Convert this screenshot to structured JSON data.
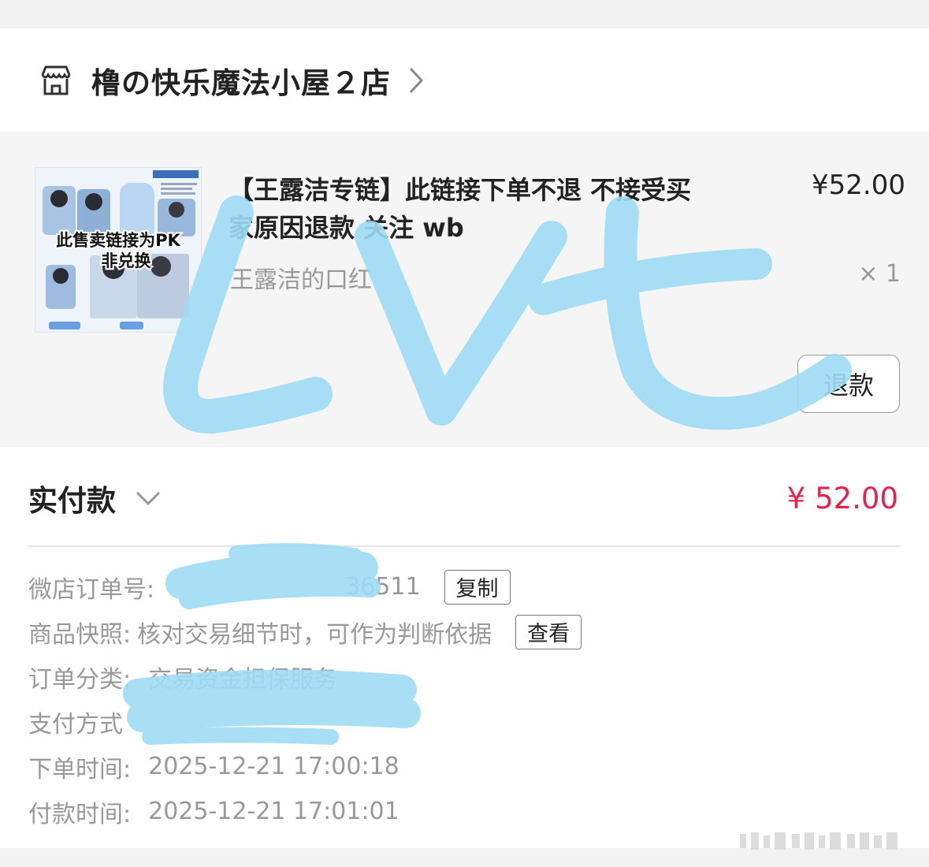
{
  "shop": {
    "name": "橹の快乐魔法小屋２店",
    "icon": "store-icon"
  },
  "product": {
    "title": "【王露洁专链】此链接下单不退 不接受买家原因退款 关注 wb",
    "price": "¥52.00",
    "sku": "王露洁的口红",
    "quantity": "× 1",
    "refund_label": "退款",
    "thumbnail_caption_line1": "此售卖链接为PK",
    "thumbnail_caption_line2": "非兑换"
  },
  "payment": {
    "label": "实付款",
    "amount": "¥ 52.00",
    "amount_color": "#e8204a"
  },
  "details": {
    "order_no_label": "微店订单号:",
    "order_no_value": "36511",
    "copy_label": "复制",
    "snapshot_label": "商品快照:",
    "snapshot_value": "核对交易细节时，可作为判断依据",
    "view_label": "查看",
    "category_label": "订单分类:",
    "category_value": "交易资金担保服务",
    "pay_method_label": "支付方式",
    "order_time_label": "下单时间:",
    "order_time_value": "2025-12-21 17:00:18",
    "pay_time_label": "付款时间:",
    "pay_time_value": "2025-12-21 17:01:01"
  },
  "overlay": {
    "scribble_text": "LVt",
    "scribble_color": "#9fdcf5"
  }
}
